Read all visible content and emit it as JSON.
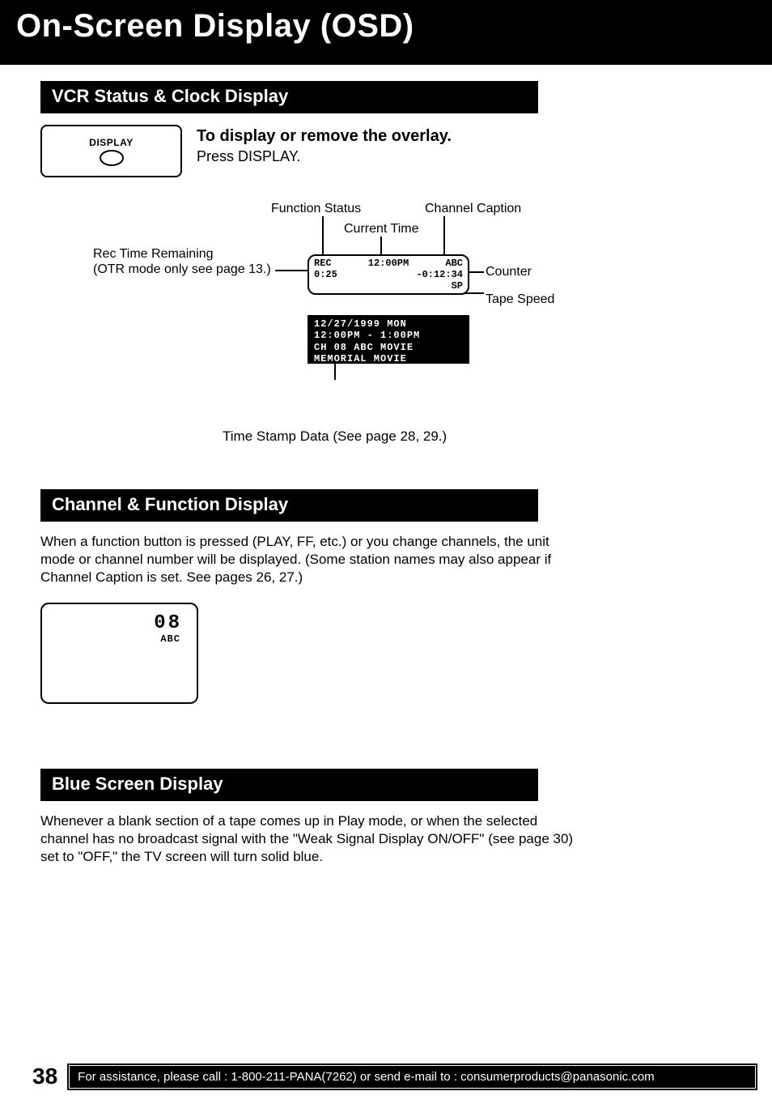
{
  "title": "On-Screen Display (OSD)",
  "section1": {
    "heading": "VCR Status & Clock Display",
    "button_label": "DISPLAY",
    "instr_bold": "To display or remove the overlay.",
    "instr_plain": "Press DISPLAY."
  },
  "diagram": {
    "labels": {
      "function_status": "Function Status",
      "current_time": "Current Time",
      "channel_caption": "Channel Caption",
      "rec_time_line1": "Rec Time Remaining",
      "rec_time_line2": "(OTR mode only see page 13.)",
      "counter": "Counter",
      "tape_speed": "Tape Speed"
    },
    "osd_main": {
      "rec": "REC",
      "rec_time": "0:25",
      "clock": "12:00PM",
      "caption": "ABC",
      "counter": "-0:12:34",
      "speed": "SP"
    },
    "osd_stamp": {
      "l1": "12/27/1999 MON",
      "l2": "12:00PM -  1:00PM",
      "l3": "CH 08 ABC  MOVIE",
      "l4": "MEMORIAL MOVIE"
    },
    "timestamp_caption": "Time Stamp Data (See page 28, 29.)"
  },
  "section2": {
    "heading": "Channel & Function Display",
    "para": "When a function button is pressed (PLAY, FF, etc.) or you change channels, the unit mode or channel number will be displayed. (Some station names may also appear if Channel Caption is set. See pages 26, 27.)",
    "channel_num": "08",
    "channel_cap": "ABC"
  },
  "section3": {
    "heading": "Blue Screen Display",
    "para": "Whenever a blank section of a tape comes up in Play mode, or when the selected channel has no broadcast signal with the \"Weak Signal Display ON/OFF\" (see page 30) set to \"OFF,\" the TV screen will turn solid blue."
  },
  "footer": {
    "page": "38",
    "bar": "For assistance, please call : 1-800-211-PANA(7262) or send e-mail to : consumerproducts@panasonic.com"
  }
}
